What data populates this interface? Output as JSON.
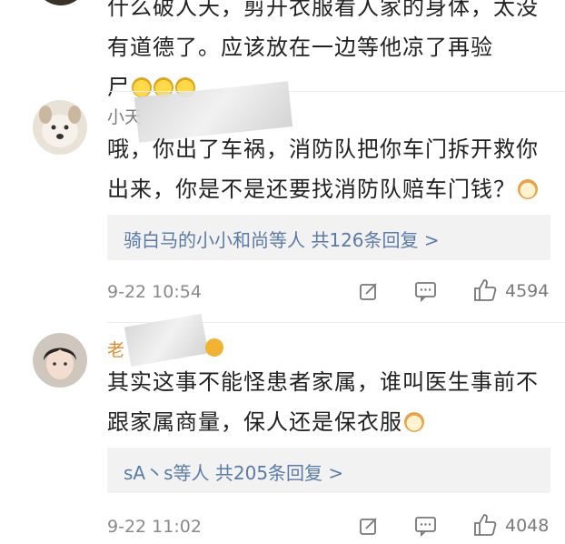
{
  "top_comment": {
    "lines": [
      "什么破人天，剪开衣服看人家的身体，太没",
      "有道德了。应该放在一边等他凉了再验",
      "尸"
    ],
    "emoji": [
      "cry-laugh-emoji",
      "cry-laugh-emoji",
      "cry-laugh-emoji"
    ]
  },
  "comments": [
    {
      "nickname": "小天",
      "avatar": "dog-avatar",
      "lines": [
        "哦，你出了车祸，消防队把你车门拆开救你",
        "出来，你是不是还要找消防队赔车门钱？"
      ],
      "emoji": "cat-face-emoji",
      "replies": "骑白马的小小和尚等人  共126条回复 >",
      "time": "9-22 10:54",
      "likes": "4594"
    },
    {
      "nickname": "老",
      "avatar": "boy-avatar",
      "lines": [
        "其实这事不能怪患者家属，谁叫医生事前不",
        "跟家属商量，保人还是保衣服"
      ],
      "emoji": "cat-face-emoji",
      "replies": "sA丶s等人  共205条回复 >",
      "time": "9-22 11:02",
      "likes": "4048"
    }
  ],
  "icons": {
    "repost": "repost-icon",
    "comment": "comment-icon",
    "like": "thumbs-up-icon"
  },
  "colors": {
    "link": "#5a7aa8",
    "reply_bg": "#f2f2f2"
  }
}
